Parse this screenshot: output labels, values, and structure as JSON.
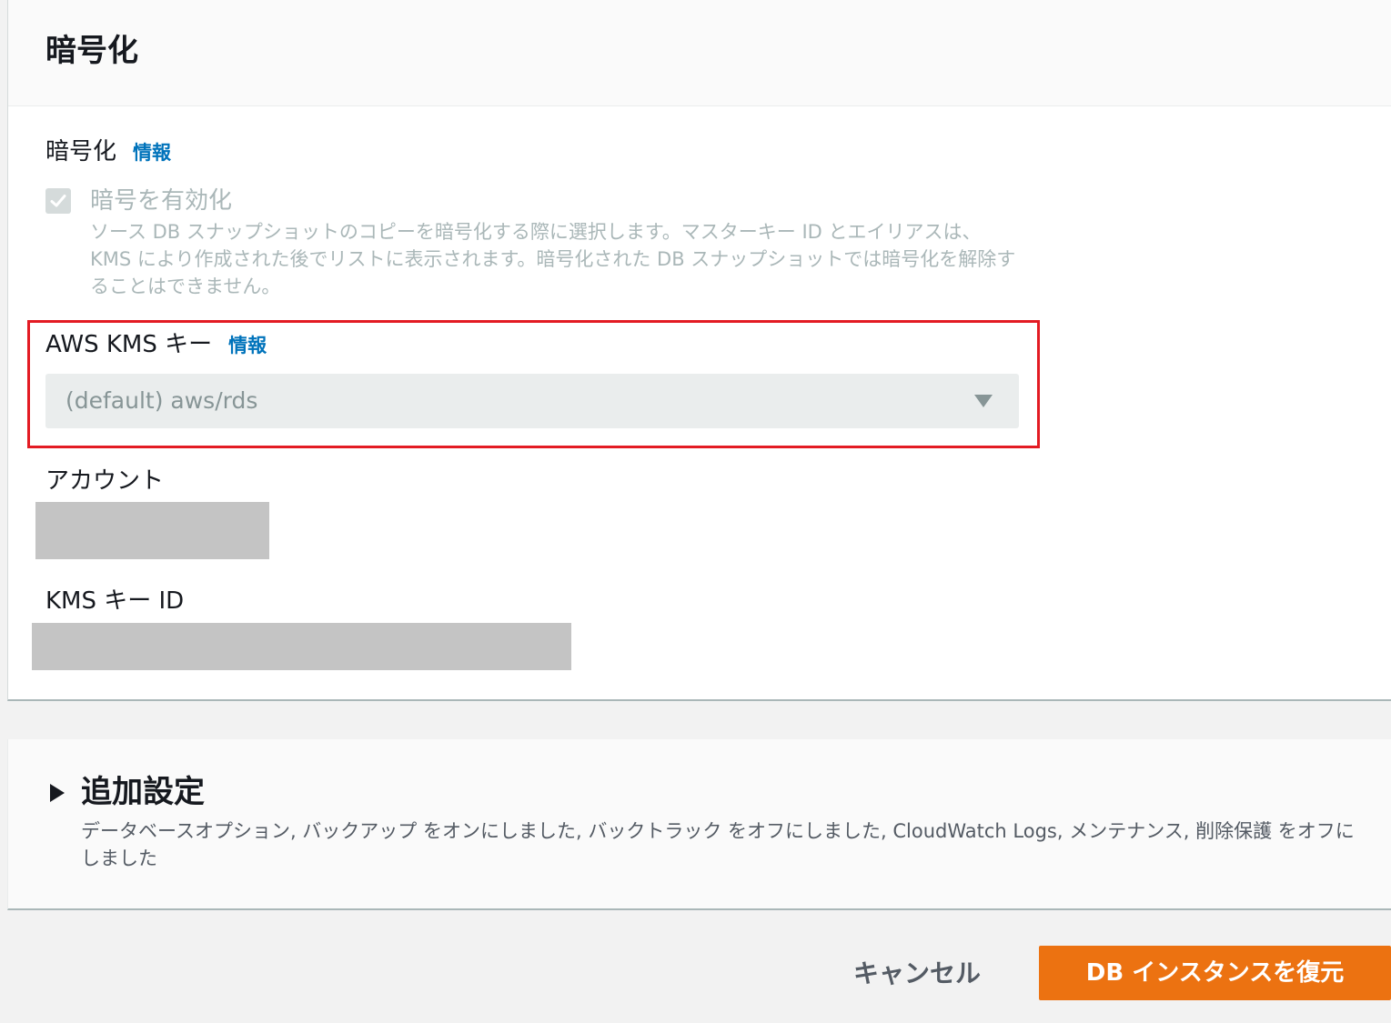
{
  "encryption_panel": {
    "title": "暗号化",
    "encryption_field": {
      "label": "暗号化",
      "info_link": "情報",
      "checkbox": {
        "label": "暗号を有効化",
        "checked": true,
        "disabled": true,
        "description": "ソース DB スナップショットのコピーを暗号化する際に選択します。マスターキー ID とエイリアスは、KMS により作成された後でリストに表示されます。暗号化された DB スナップショットでは暗号化を解除することはできません。"
      }
    },
    "kms_key_field": {
      "label": "AWS KMS キー",
      "info_link": "情報",
      "selected_value": "(default) aws/rds",
      "caret_icon": "triangle-down-icon"
    },
    "account_field": {
      "label": "アカウント"
    },
    "kms_key_id_field": {
      "label": "KMS キー ID"
    }
  },
  "additional_panel": {
    "title": "追加設定",
    "expand_icon": "triangle-right-icon",
    "description": "データベースオプション, バックアップ をオンにしました, バックトラック をオフにしました, CloudWatch Logs, メンテナンス, 削除保護 をオフにしました"
  },
  "footer": {
    "cancel_label": "キャンセル",
    "submit_label": "DB インスタンスを復元"
  },
  "colors": {
    "primary_button": "#ec7211",
    "info_link": "#0073bb",
    "highlight_border": "#e31b23",
    "redacted": "#c4c4c4"
  }
}
